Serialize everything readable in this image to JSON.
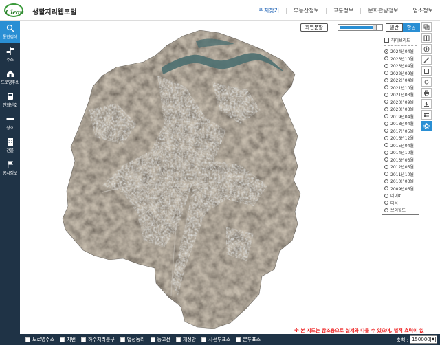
{
  "header": {
    "logo_text": "Clean",
    "title": "생활지리웹포털",
    "nav": [
      "위치찾기",
      "부동산정보",
      "교통정보",
      "문화관광정보",
      "업소정보"
    ]
  },
  "sidebar": {
    "items": [
      {
        "label": "통합검색",
        "icon": "search-icon",
        "active": true
      },
      {
        "label": "주소",
        "icon": "signpost-icon",
        "active": false
      },
      {
        "label": "도로명주소",
        "icon": "house-icon",
        "active": false
      },
      {
        "label": "전화번호",
        "icon": "phone-icon",
        "active": false
      },
      {
        "label": "상호",
        "icon": "signboard-icon",
        "active": false
      },
      {
        "label": "건물",
        "icon": "building-icon",
        "active": false
      },
      {
        "label": "공시정보",
        "icon": "flag-icon",
        "active": false
      }
    ],
    "handle_glyph": "›"
  },
  "map_controls": {
    "split_label": "화면분할",
    "mode_normal": "일반",
    "mode_satellite": "항공",
    "satellite_opacity": 0.85
  },
  "date_panel": {
    "hybrid_label": "하이브리드",
    "dates": [
      "2024년04월",
      "2023년10월",
      "2023년04월",
      "2022년09월",
      "2022년04월",
      "2021년10월",
      "2021년03월",
      "2020년09월",
      "2020년03월",
      "2019년04월",
      "2018년04월",
      "2017년05월",
      "2016년12월",
      "2015년04월",
      "2014년10월",
      "2013년03월",
      "2012년05월",
      "2011년10월",
      "2010년03월",
      "2009년06월"
    ],
    "providers": [
      "네이버",
      "다음",
      "브이월드"
    ],
    "selected_index": 0
  },
  "toolbar": {
    "tools": [
      "layers-icon",
      "grid-icon",
      "compass-icon",
      "ruler-icon",
      "area-icon",
      "refresh-icon",
      "print-icon",
      "save-icon",
      "legend-icon",
      "settings-icon"
    ],
    "selected": "settings-icon"
  },
  "notice": "※ 본 지도는 참조용으로 실제와 다를 수 있으며, 법적 효력이 없",
  "bottombar": {
    "layers": [
      "도로명주소",
      "지번",
      "하수처리분구",
      "법정동리",
      "등고선",
      "재정방",
      "사전투표소",
      "본투표소"
    ],
    "scale_label": "축척 :",
    "scale_value": "150000"
  }
}
